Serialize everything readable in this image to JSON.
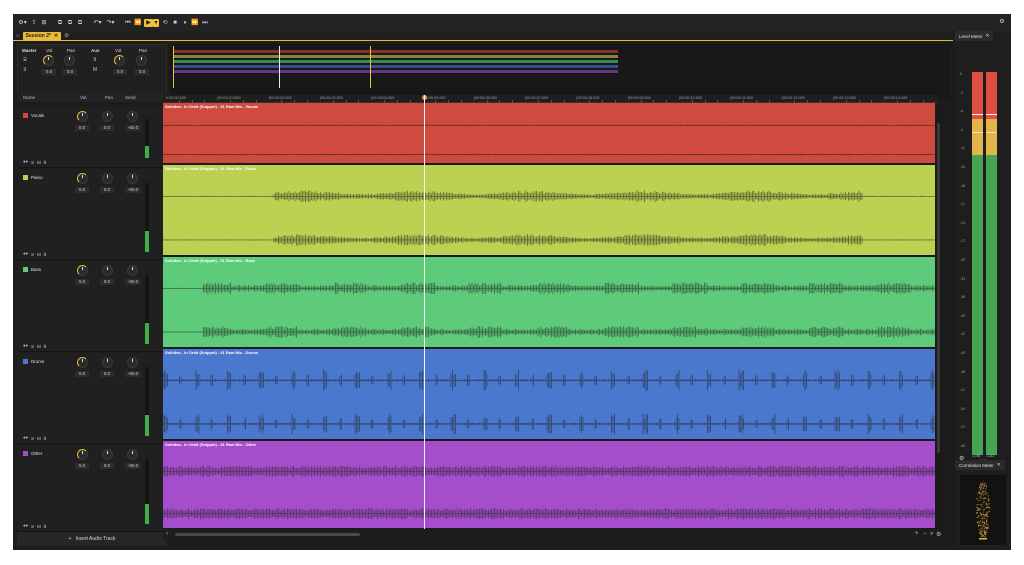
{
  "toolbar": {
    "icons": [
      "gear-icon",
      "export-icon",
      "import-icon",
      "copy-icon",
      "paste-icon",
      "duplicate-icon",
      "undo-icon",
      "redo-icon",
      "skip-start-icon",
      "rewind-icon",
      "play-icon",
      "loop-icon",
      "stop-icon",
      "pause-icon",
      "fast-forward-icon",
      "skip-end-icon"
    ],
    "glyph_gear": "⚙",
    "glyph_export": "⇪",
    "glyph_import": "⊞",
    "glyph_copy": "⧉",
    "glyph_paste": "⧉",
    "glyph_dup": "⧉",
    "glyph_undo": "↶",
    "glyph_redo": "↷",
    "glyph_skipstart": "⏮",
    "glyph_rewind": "⏪",
    "glyph_play": "▶",
    "glyph_loop": "⟲",
    "glyph_stop": "■",
    "glyph_pause": "⏸",
    "glyph_ff": "⏩",
    "glyph_skipend": "⏭",
    "glyph_caret": "▾",
    "glyph_settings": "⚙"
  },
  "tabs": {
    "home_glyph": "⌂",
    "session_label": "Session 2*",
    "close_glyph": "✕",
    "add_glyph": "⊕"
  },
  "master": {
    "label": "Master",
    "vol_label": "Vol.",
    "pan_label": "Pan",
    "vol_value": "0.0",
    "pan_value": "0.0"
  },
  "aux": {
    "label": "Aux",
    "vol_label": "Vol.",
    "pan_label": "Pan",
    "vol_value": "0.0",
    "pan_value": "0.0",
    "m_label": "M"
  },
  "track_header": {
    "name": "Name",
    "vol": "Vol.",
    "pan": "Pan",
    "send": "Send"
  },
  "tracks": [
    {
      "name": "Vocals",
      "color": "#cf4a3f",
      "vol": "0.0",
      "pan": "0.0",
      "send": "-60.0",
      "clip_title": "Solidtea - In Orbit (Snippet) - 01 Raw Mix - Vocals",
      "meter_level": 0.12
    },
    {
      "name": "Piano",
      "color": "#bcd052",
      "vol": "0.0",
      "pan": "0.0",
      "send": "-60.0",
      "clip_title": "Solidtea - In Orbit (Snippet) - 01 Raw Mix - Piano",
      "meter_level": 0.42
    },
    {
      "name": "Bass",
      "color": "#5dcb7a",
      "vol": "0.0",
      "pan": "0.0",
      "send": "-60.0",
      "clip_title": "Solidtea - In Orbit (Snippet) - 01 Raw Mix - Bass",
      "meter_level": 0.62
    },
    {
      "name": "Drums",
      "color": "#4a78cf",
      "vol": "0.0",
      "pan": "0.0",
      "send": "-60.0",
      "clip_title": "Solidtea - In Orbit (Snippet) - 01 Raw Mix - Drums",
      "meter_level": 0.78
    },
    {
      "name": "Other",
      "color": "#a54ecc",
      "vol": "0.0",
      "pan": "0.0",
      "send": "-60.0",
      "clip_title": "Solidtea - In Orbit (Snippet) - 01 Raw Mix - Other",
      "meter_level": 0.65
    }
  ],
  "row_buttons": {
    "dot": "●▾",
    "solo": "S",
    "mute": "M",
    "fx": "⌷"
  },
  "insert_track": {
    "icon": "+",
    "label": "Insert Audio Track"
  },
  "ruler": {
    "labels": [
      "0:00:00:000",
      "|00:00:01:000",
      "|00:00:02:000",
      "|00:00:03:000",
      "|00:00:04:000",
      "|00:00:05:000",
      "|00:00:06:000",
      "|00:00:07:000",
      "|00:00:08:000",
      "|00:00:09:000",
      "|00:00:10:000",
      "|00:00:11:000",
      "|00:00:12:000",
      "|00:00:13:000",
      "|00:00:14:000"
    ]
  },
  "scroll": {
    "left_glyph": "‹",
    "right_glyph": "›",
    "zoom_in": "+",
    "zoom_out": "−",
    "fit": "»",
    "settings": "⚙"
  },
  "level_meter": {
    "title": "Level Meter",
    "close": "✕",
    "scale": [
      "0",
      "-3",
      "-6",
      "-9",
      "-12",
      "-15",
      "-18",
      "-21",
      "-24",
      "-27",
      "-30",
      "-33",
      "-36",
      "-39",
      "-42",
      "-45",
      "-48",
      "-51",
      "-54",
      "-57",
      "-60"
    ],
    "readout_left": "-1.46",
    "readout_right": "-1.81",
    "readout_peak": "-4.46",
    "settings_glyph": "⚙"
  },
  "correlation_meter": {
    "title": "Correlation Meter",
    "close": "✕"
  },
  "playhead_position": "0:00:08:000"
}
